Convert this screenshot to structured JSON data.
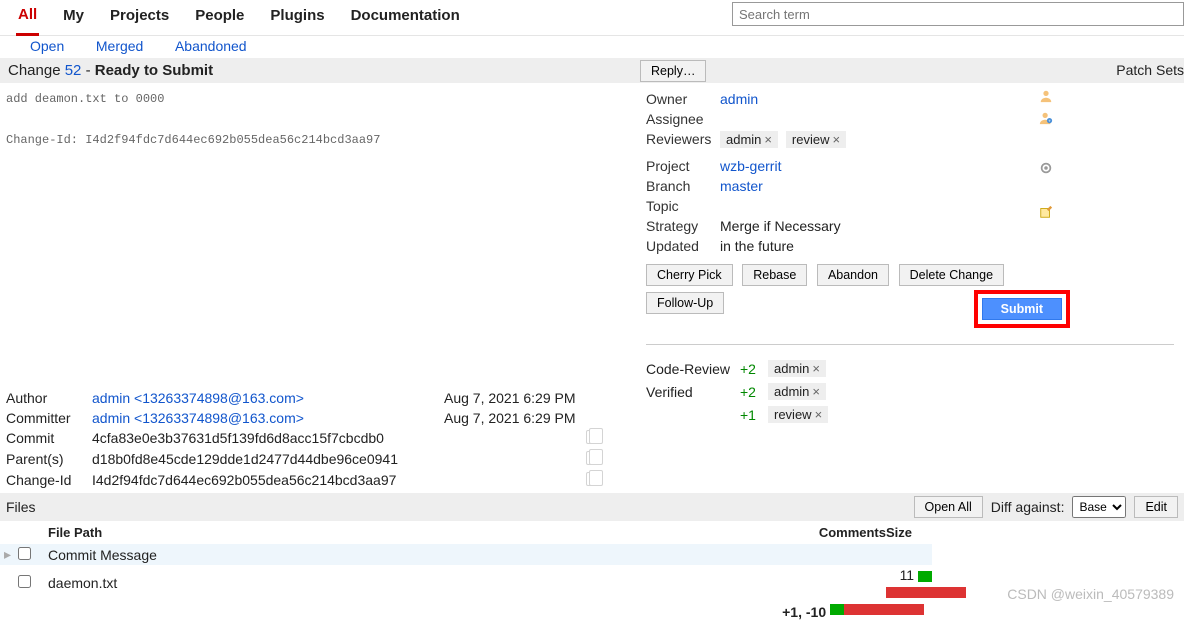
{
  "nav": {
    "items": [
      "All",
      "My",
      "Projects",
      "People",
      "Plugins",
      "Documentation"
    ],
    "active_index": 0,
    "sub": [
      "Open",
      "Merged",
      "Abandoned"
    ]
  },
  "search": {
    "placeholder": "Search term"
  },
  "change": {
    "label_prefix": "Change ",
    "number": "52",
    "dash": " - ",
    "status": "Ready to Submit",
    "reply_label": "Reply…",
    "patchsets_label": "Patch Sets",
    "commit_msg": "add deamon.txt to 0000\n\nChange-Id: I4d2f94fdc7d644ec692b055dea56c214bcd3aa97"
  },
  "meta": {
    "owner_label": "Owner",
    "owner": "admin",
    "assignee_label": "Assignee",
    "assignee": "",
    "reviewers_label": "Reviewers",
    "reviewers": [
      "admin",
      "review"
    ],
    "project_label": "Project",
    "project": "wzb-gerrit",
    "branch_label": "Branch",
    "branch": "master",
    "topic_label": "Topic",
    "topic": "",
    "strategy_label": "Strategy",
    "strategy": "Merge if Necessary",
    "updated_label": "Updated",
    "updated": "in the future"
  },
  "actions": {
    "cherry_pick": "Cherry Pick",
    "rebase": "Rebase",
    "abandon": "Abandon",
    "delete": "Delete Change",
    "follow_up": "Follow-Up",
    "submit": "Submit"
  },
  "commit": {
    "author_label": "Author",
    "author": "admin <13263374898@163.com>",
    "author_date": "Aug 7, 2021 6:29 PM",
    "committer_label": "Committer",
    "committer": "admin <13263374898@163.com>",
    "committer_date": "Aug 7, 2021 6:29 PM",
    "commit_label": "Commit",
    "commit": "4cfa83e0e3b37631d5f139fd6d8acc15f7cbcdb0",
    "parents_label": "Parent(s)",
    "parents": "d18b0fd8e45cde129dde1d2477d44dbe96ce0941",
    "changeid_label": "Change-Id",
    "changeid": "I4d2f94fdc7d644ec692b055dea56c214bcd3aa97"
  },
  "review": {
    "code_review_label": "Code-Review",
    "verified_label": "Verified",
    "rows": [
      {
        "label": "Code-Review",
        "score": "+2",
        "who": "admin"
      },
      {
        "label": "Verified",
        "score": "+2",
        "who": "admin"
      },
      {
        "label": "",
        "score": "+1",
        "who": "review"
      }
    ]
  },
  "files": {
    "title": "Files",
    "open_all": "Open All",
    "diff_against": "Diff against:",
    "base": "Base",
    "edit": "Edit",
    "headers": {
      "path": "File Path",
      "comments": "Comments",
      "size": "Size"
    },
    "rows": [
      {
        "path": "Commit Message",
        "size": "",
        "added": 0,
        "removed": 0
      },
      {
        "path": "daemon.txt",
        "size": "11",
        "added": 14,
        "removed": 80
      }
    ],
    "totals": "+1, -10"
  },
  "watermark": "CSDN @weixin_40579389"
}
